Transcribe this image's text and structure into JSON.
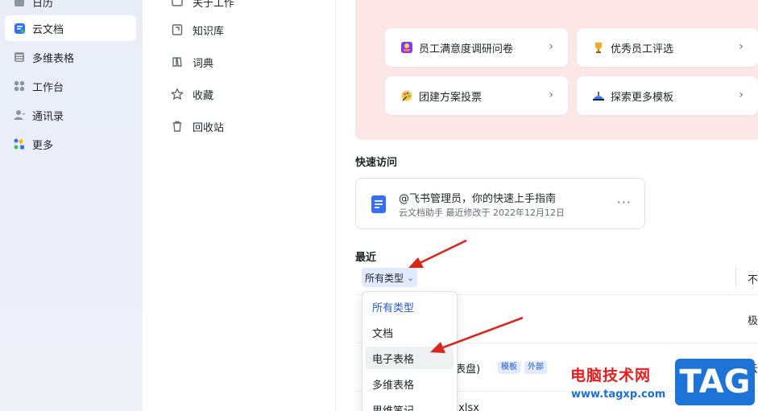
{
  "nav": {
    "items": [
      {
        "label": "日历"
      },
      {
        "label": "云文档"
      },
      {
        "label": "多维表格"
      },
      {
        "label": "工作台"
      },
      {
        "label": "通讯录"
      },
      {
        "label": "更多"
      }
    ]
  },
  "docs_nav": {
    "items": [
      {
        "label": "关于工作"
      },
      {
        "label": "知识库"
      },
      {
        "label": "词典"
      },
      {
        "label": "收藏"
      },
      {
        "label": "回收站"
      }
    ]
  },
  "templates": [
    {
      "label": "员工满意度调研问卷",
      "icon": "survey-icon"
    },
    {
      "label": "优秀员工评选",
      "icon": "trophy-icon"
    },
    {
      "label": "团建方案投票",
      "icon": "palette-icon"
    },
    {
      "label": "探索更多模板",
      "icon": "explore-icon"
    }
  ],
  "quick_access": {
    "title": "快速访问",
    "card_title": "@飞书管理员，你的快速上手指南",
    "card_meta": "云文档助手 最近修改于 2022年12月12日",
    "more": "···"
  },
  "recent": {
    "title": "最近",
    "filter_label": "所有类型",
    "right_header": "不",
    "rows": [
      {
        "name": "",
        "right": "极"
      },
      {
        "name": "(表盘)",
        "tags": [
          "模板",
          "外部"
        ],
        "right": "云"
      },
      {
        "name": ".xlsx",
        "right": ""
      }
    ]
  },
  "dropdown": {
    "options": [
      "所有类型",
      "文档",
      "电子表格",
      "多维表格",
      "思维笔记"
    ],
    "selected": "所有类型",
    "hovered": "电子表格"
  },
  "watermark": {
    "site_name": "电脑技术网",
    "url": "www.tagxp.com",
    "badge": "TAG"
  },
  "colors": {
    "accent": "#3370ff",
    "banner": "#fde6e6",
    "arrow": "#d9261c"
  }
}
